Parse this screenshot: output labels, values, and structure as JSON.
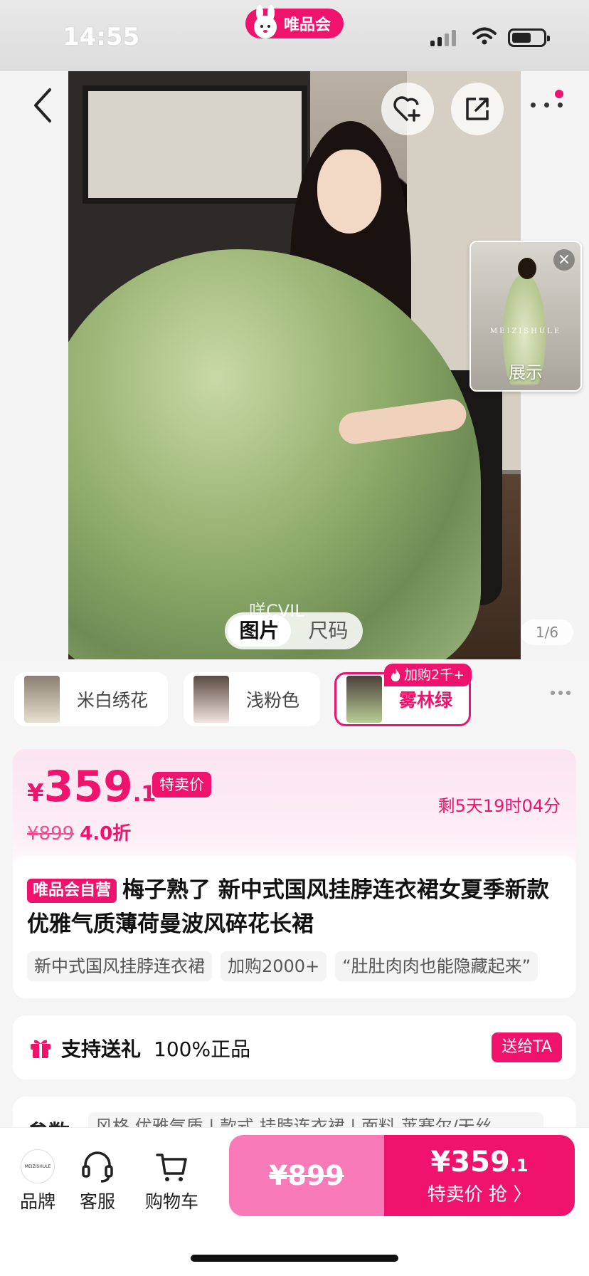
{
  "status": {
    "time": "14:55",
    "app_pill": "唯品会"
  },
  "hero": {
    "mini_caption": "展示",
    "mini_brand": "MEIZISHULE",
    "ghost_text": "咩CVIL",
    "toggle": [
      "图片",
      "尺码"
    ],
    "page_indicator": "1/6",
    "icons": [
      "back-icon",
      "favorite-add-icon",
      "share-icon",
      "more-icon"
    ]
  },
  "variants": [
    {
      "label": "米白绣花"
    },
    {
      "label": "浅粉色"
    },
    {
      "label": "雾林绿",
      "badge": "加购2千+"
    }
  ],
  "price": {
    "currency": "¥",
    "integer": "359",
    "decimal": ".1",
    "sale_tag": "特卖价",
    "original": "¥899",
    "discount": "4.0折",
    "countdown": "剩5天19时04分"
  },
  "product": {
    "self_tag": "唯品会自营",
    "title": "梅子熟了 新中式国风挂脖连衣裙女夏季新款优雅气质薄荷曼波风碎花长裙",
    "chips": [
      "新中式国风挂脖连衣裙",
      "加购2000+",
      "“肚肚肉肉也能隐藏起来”"
    ]
  },
  "gift": {
    "label": "支持送礼",
    "authentic": "100%正品",
    "button": "送给TA"
  },
  "params": {
    "title": "参数",
    "values": "风格 优雅气质 | 款式 挂脖连衣裙 | 面料 莱赛尔/天丝"
  },
  "bottom": {
    "brand_logo": "MEIZISHULE",
    "brand_label": "品牌",
    "service_label": "客服",
    "cart_label": "购物车",
    "orig_price": "¥899",
    "buy_price_int": "¥359",
    "buy_price_dec": ".1",
    "buy_label": "特卖价 抢 〉"
  },
  "colors": {
    "accent": "#f0136e",
    "accent_light": "#f97ab8"
  }
}
